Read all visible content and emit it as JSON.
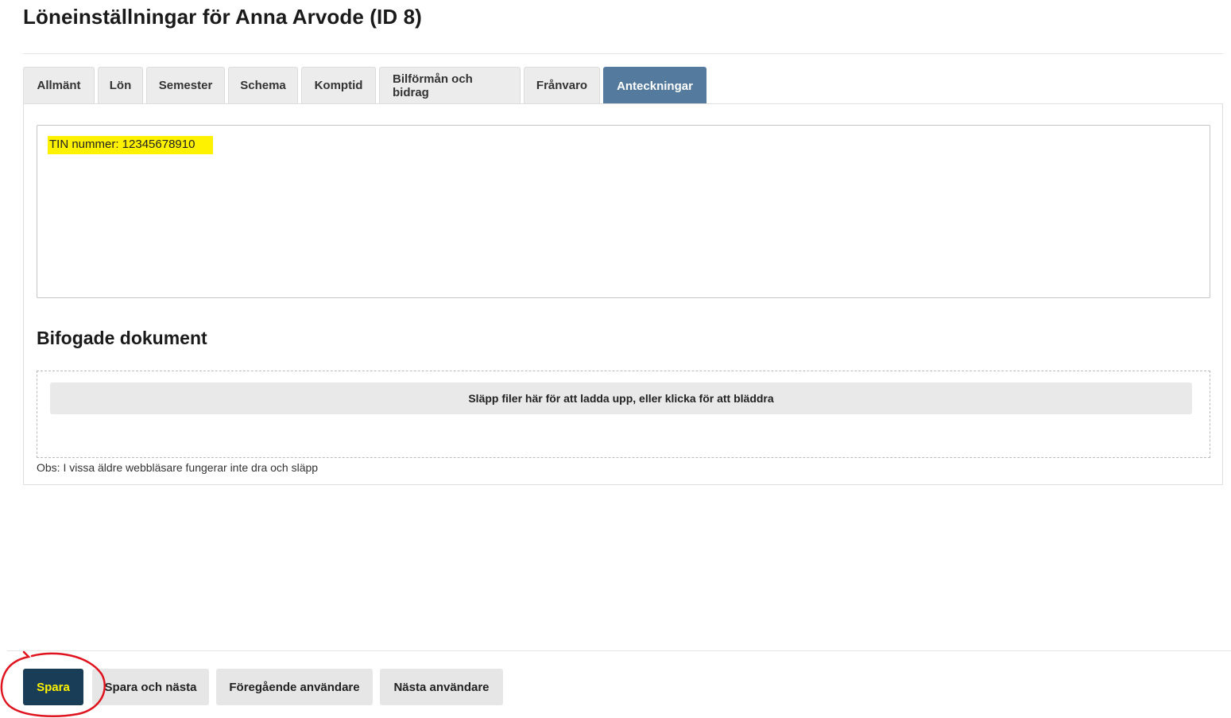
{
  "page": {
    "title": "Löneinställningar för Anna Arvode (ID 8)"
  },
  "tabs": [
    {
      "label": "Allmänt",
      "active": false
    },
    {
      "label": "Lön",
      "active": false
    },
    {
      "label": "Semester",
      "active": false
    },
    {
      "label": "Schema",
      "active": false
    },
    {
      "label": "Komptid",
      "active": false
    },
    {
      "label": "Bilförmån och bidrag",
      "active": false
    },
    {
      "label": "Frånvaro",
      "active": false
    },
    {
      "label": "Anteckningar",
      "active": true
    }
  ],
  "notes": {
    "value": "TIN nummer: 12345678910",
    "highlight_color": "#fff200"
  },
  "attachments": {
    "title": "Bifogade dokument",
    "dropzone_text": "Släpp filer här för att ladda upp, eller klicka för att bläddra",
    "note": "Obs: I vissa äldre webbläsare fungerar inte dra och släpp"
  },
  "footer": {
    "save": "Spara",
    "save_next": "Spara och nästa",
    "prev_user": "Föregående användare",
    "next_user": "Nästa användare"
  },
  "colors": {
    "active_tab": "#547a9d",
    "save_button": "#1a3d57",
    "annotation": "#e0141e"
  }
}
